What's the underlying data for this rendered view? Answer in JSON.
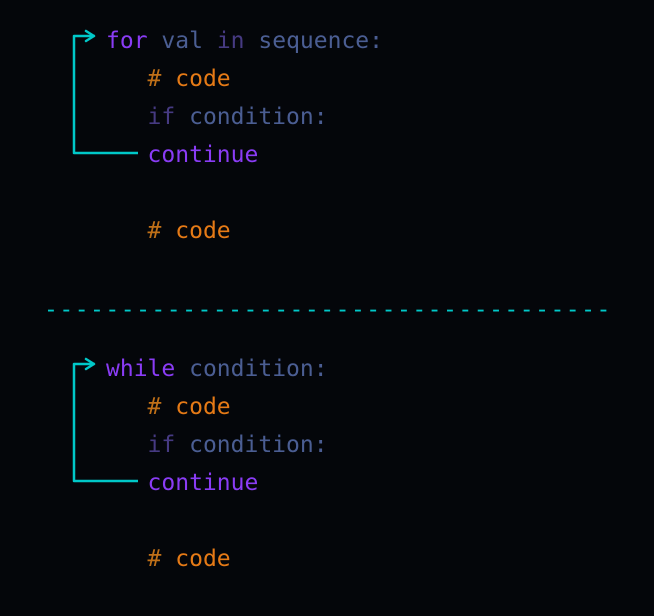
{
  "for_block": {
    "kw_for": "for",
    "var": "val",
    "kw_in": "in",
    "seq": "sequence",
    "colon": ":",
    "comment1_hash": "#",
    "comment1_word": "code",
    "kw_if": "if",
    "cond": "condition",
    "colon2": ":",
    "kw_continue": "continue",
    "comment2_hash": "#",
    "comment2_word": "code"
  },
  "while_block": {
    "kw_while": "while",
    "cond": "condition",
    "colon": ":",
    "comment1_hash": "#",
    "comment1_word": "code",
    "kw_if": "if",
    "cond2": "condition",
    "colon2": ":",
    "kw_continue": "continue",
    "comment2_hash": "#",
    "comment2_word": "code"
  },
  "divider": "----------------------------------------",
  "arrow_color": "#00c8c8"
}
